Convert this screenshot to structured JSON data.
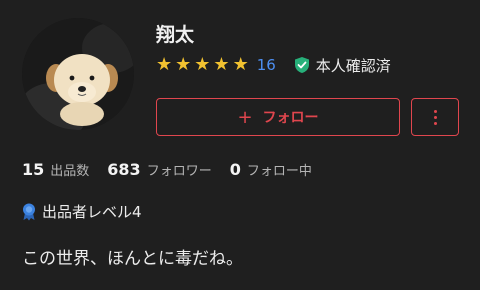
{
  "profile": {
    "name": "翔太",
    "rating": {
      "stars": 5,
      "review_count": "16"
    },
    "verified_label": "本人確認済",
    "follow_label": "フォロー",
    "follow_plus": "+",
    "stats": [
      {
        "num": "15",
        "label": "出品数"
      },
      {
        "num": "683",
        "label": "フォロワー"
      },
      {
        "num": "0",
        "label": "フォロー中"
      }
    ],
    "seller_level": "出品者レベル4",
    "bio": "この世界、ほんとに毒だね。"
  },
  "icons": {
    "star": "star-icon",
    "verified": "shield-check-icon",
    "more": "more-vertical-icon",
    "level": "badge-ribbon-icon"
  },
  "colors": {
    "background": "#1f1f1f",
    "accent": "#e0464e",
    "star": "#f2c230",
    "link": "#4d8ff2",
    "verified": "#27b07a",
    "badge": "#3b82e0"
  }
}
